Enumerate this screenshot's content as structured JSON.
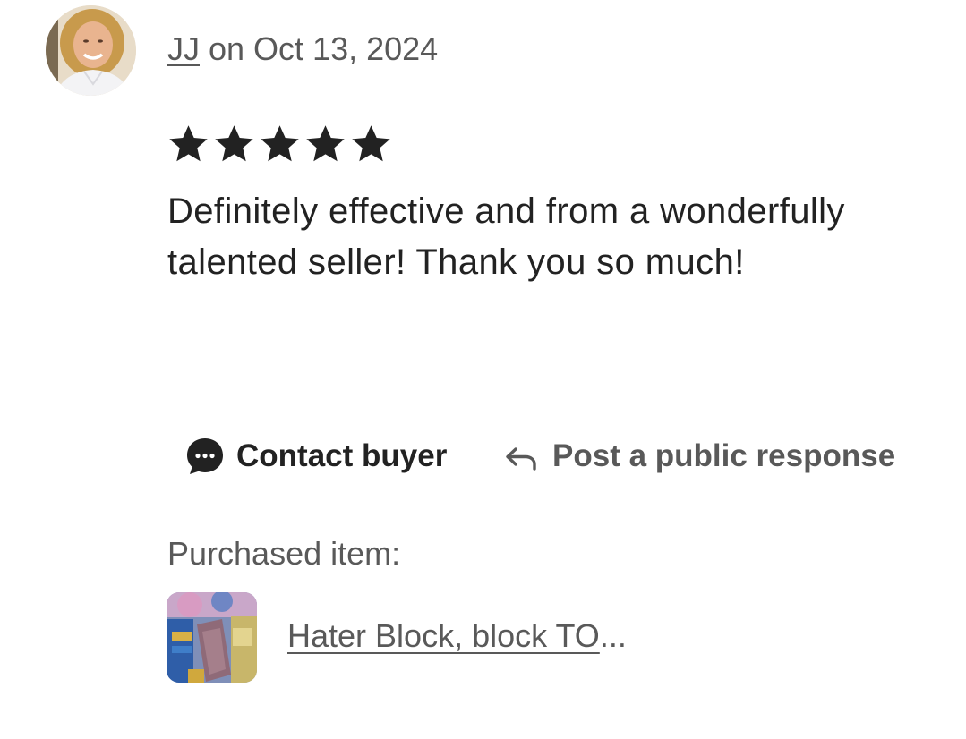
{
  "review": {
    "reviewer_name": "JJ",
    "date_prefix": " on ",
    "date": "Oct 13, 2024",
    "rating": 5,
    "rating_max": 5,
    "text": "Definitely effective and from a wonderfully talented seller! Thank you so much!"
  },
  "actions": {
    "contact_label": "Contact buyer",
    "contact_icon": "chat-bubble-icon",
    "respond_label": "Post a public response",
    "respond_icon": "reply-arrow-icon"
  },
  "purchase": {
    "label": "Purchased item:",
    "item_title": "Hater Block, block TO",
    "ellipsis": "..."
  },
  "colors": {
    "primary_text": "#222222",
    "secondary_text": "#595959",
    "background": "#ffffff",
    "star": "#222222"
  }
}
